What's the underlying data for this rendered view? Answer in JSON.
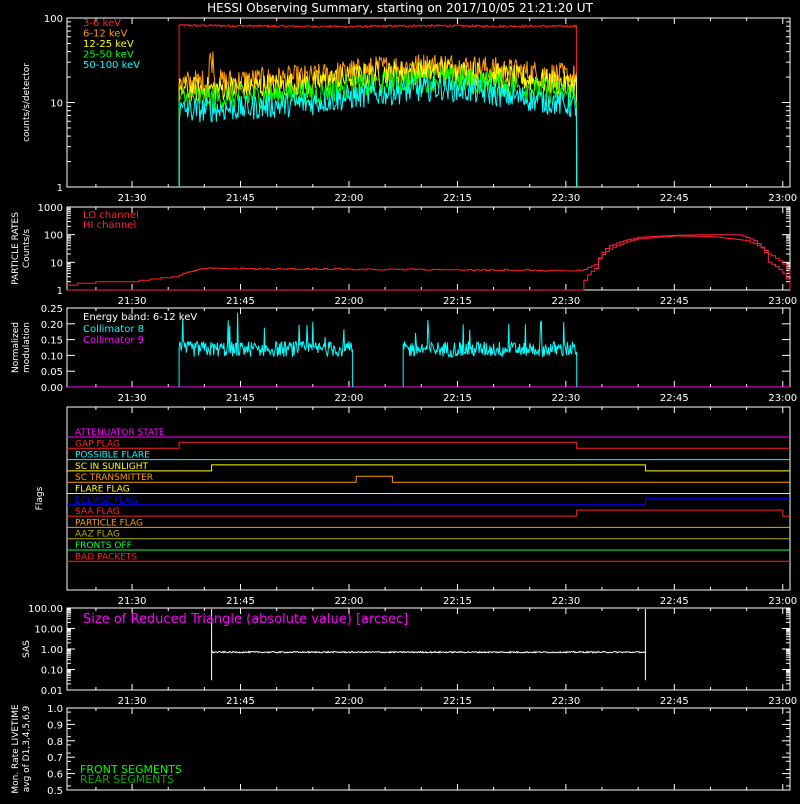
{
  "title": "HESSI Observing Summary, starting on 2017/10/05 21:21:20 UT",
  "time_axis": {
    "range_min": [
      1281,
      1381
    ],
    "ticks": [
      "21:30",
      "21:45",
      "22:00",
      "22:15",
      "22:30",
      "22:45",
      "23:00"
    ],
    "tick_min": [
      1290,
      1305,
      1320,
      1335,
      1350,
      1365,
      1380
    ]
  },
  "colors": {
    "axis": "#ffffff",
    "red": "#ff2020",
    "orange": "#ff9a00",
    "yellow": "#ffff00",
    "green": "#00ff00",
    "cyan": "#00ffff",
    "magenta": "#ff00ff",
    "crimson": "#ff2050",
    "blue": "#0000ff",
    "olive": "#b0b000",
    "brightgreen": "#00ff40",
    "darkgreen": "#00b000"
  },
  "chart_data": [
    {
      "type": "line",
      "panel": "count_rates",
      "ylabel": "counts/s/detector",
      "yscale": "log",
      "ylim": [
        1,
        100
      ],
      "yticks": [
        "1",
        "10",
        "100"
      ],
      "data_window_min": [
        1296.5,
        1351.5
      ],
      "series": [
        {
          "name": "3-6 keV",
          "color": "#ff2020",
          "x": [
            1296.5,
            1310,
            1320,
            1330,
            1340,
            1351.5
          ],
          "y": [
            82,
            80,
            79,
            81,
            80,
            80
          ]
        },
        {
          "name": "6-12 keV",
          "color": "#ff9a00",
          "x": [
            1296.5,
            1305,
            1315,
            1325,
            1333,
            1342,
            1351.5
          ],
          "y": [
            17,
            18,
            20,
            26,
            28,
            24,
            20
          ]
        },
        {
          "name": "12-25 keV",
          "color": "#ffff00",
          "x": [
            1296.5,
            1305,
            1315,
            1325,
            1333,
            1342,
            1351.5
          ],
          "y": [
            14,
            15,
            17,
            22,
            24,
            20,
            16
          ]
        },
        {
          "name": "25-50 keV",
          "color": "#00ff00",
          "x": [
            1296.5,
            1305,
            1315,
            1325,
            1333,
            1342,
            1351.5
          ],
          "y": [
            11,
            11.5,
            13,
            17,
            19,
            16,
            12
          ]
        },
        {
          "name": "50-100 keV",
          "color": "#00ffff",
          "x": [
            1296.5,
            1305,
            1315,
            1325,
            1333,
            1342,
            1351.5
          ],
          "y": [
            8,
            8.5,
            10,
            13,
            15,
            12,
            9
          ]
        }
      ]
    },
    {
      "type": "line",
      "panel": "particle_rates",
      "ylabel": "PARTICLE RATES",
      "ylabel2": "Counts/s",
      "yscale": "log",
      "ylim": [
        1,
        1000
      ],
      "yticks": [
        "1",
        "10",
        "100",
        "1000"
      ],
      "series": [
        {
          "name": "LO channel",
          "color": "#ff2020",
          "x": [
            1281,
            1286,
            1290,
            1296,
            1300,
            1352,
            1354,
            1356,
            1360,
            1365,
            1370,
            1375,
            1378,
            1381
          ],
          "y": [
            1.5,
            2,
            2,
            3,
            6,
            5,
            8,
            30,
            70,
            90,
            85,
            60,
            20,
            3
          ]
        },
        {
          "name": "HI channel",
          "color": "#ff2050",
          "x": [
            1281,
            1352,
            1354,
            1356,
            1360,
            1365,
            1370,
            1374,
            1376,
            1378,
            1381
          ],
          "y": [
            1,
            1,
            6,
            40,
            80,
            95,
            100,
            98,
            60,
            10,
            1
          ]
        }
      ]
    },
    {
      "type": "line",
      "panel": "modulation",
      "ylabel": "Normalized",
      "ylabel2": "modulation",
      "ylim": [
        0,
        0.25
      ],
      "yticks": [
        "0.00",
        "0.05",
        "0.10",
        "0.15",
        "0.20",
        "0.25"
      ],
      "legend_header": "Energy band: 6-12 keV",
      "series": [
        {
          "name": "Collimator 8",
          "color": "#00ffff",
          "segments_min": [
            [
              1296.5,
              1320.5
            ],
            [
              1327.5,
              1351.5
            ]
          ],
          "level": 0.12
        },
        {
          "name": "Collimator 9",
          "color": "#ff00ff",
          "level": 0.0
        }
      ]
    },
    {
      "type": "table",
      "panel": "flags",
      "ylabel": "Flags",
      "flags": [
        {
          "name": "ATTENUATOR STATE",
          "color": "#ff00ff",
          "steps": []
        },
        {
          "name": "GAP FLAG",
          "color": "#ff2020",
          "steps": [
            [
              1296.5,
              1
            ],
            [
              1351.5,
              0
            ]
          ]
        },
        {
          "name": "POSSIBLE FLARE",
          "color": "#00ffff",
          "steps": []
        },
        {
          "name": "SC IN SUNLIGHT",
          "color": "#ffff00",
          "steps": [
            [
              1301,
              1
            ],
            [
              1361,
              0
            ]
          ]
        },
        {
          "name": "SC TRANSMITTER",
          "color": "#ff9a00",
          "steps": [
            [
              1321,
              1
            ],
            [
              1326,
              0
            ]
          ]
        },
        {
          "name": "FLARE FLAG",
          "color": "#ffff00",
          "steps": []
        },
        {
          "name": "ECLIPSE FLAG",
          "color": "#0000ff",
          "steps": [
            [
              1301,
              0
            ],
            [
              1361,
              1
            ]
          ]
        },
        {
          "name": "SAA FLAG",
          "color": "#ff2020",
          "steps": [
            [
              1351.5,
              1
            ],
            [
              1380,
              0
            ]
          ]
        },
        {
          "name": "PARTICLE FLAG",
          "color": "#ff9a00",
          "steps": []
        },
        {
          "name": "AAZ FLAG",
          "color": "#b0b000",
          "steps": []
        },
        {
          "name": "FRONTS OFF",
          "color": "#00ff40",
          "steps": []
        },
        {
          "name": "BAD PACKETS",
          "color": "#ff2020",
          "steps": []
        }
      ]
    },
    {
      "type": "line",
      "panel": "sas",
      "ylabel": "SAS",
      "yscale": "log",
      "ylim": [
        0.01,
        100
      ],
      "yticks": [
        "0.01",
        "0.10",
        "1.00",
        "10.00",
        "100.00"
      ],
      "annotation": "Size of Reduced Triangle (absolute value) [arcsec]",
      "series": [
        {
          "name": "",
          "color": "#ffffff",
          "x": [
            1301,
            1361
          ],
          "y": [
            0.7,
            0.7
          ]
        }
      ]
    },
    {
      "type": "line",
      "panel": "livetime",
      "ylabel": "Mon. Rate LIVETIME",
      "ylabel2": "avg of D1,3,4,5,6,9",
      "ylim": [
        0.5,
        1.0
      ],
      "yticks": [
        "0.5",
        "0.6",
        "0.7",
        "0.8",
        "0.9",
        "1.0"
      ],
      "series": [
        {
          "name": "FRONT SEGMENTS",
          "color": "#00ff00"
        },
        {
          "name": "REAR SEGMENTS",
          "color": "#00b000"
        }
      ]
    }
  ]
}
